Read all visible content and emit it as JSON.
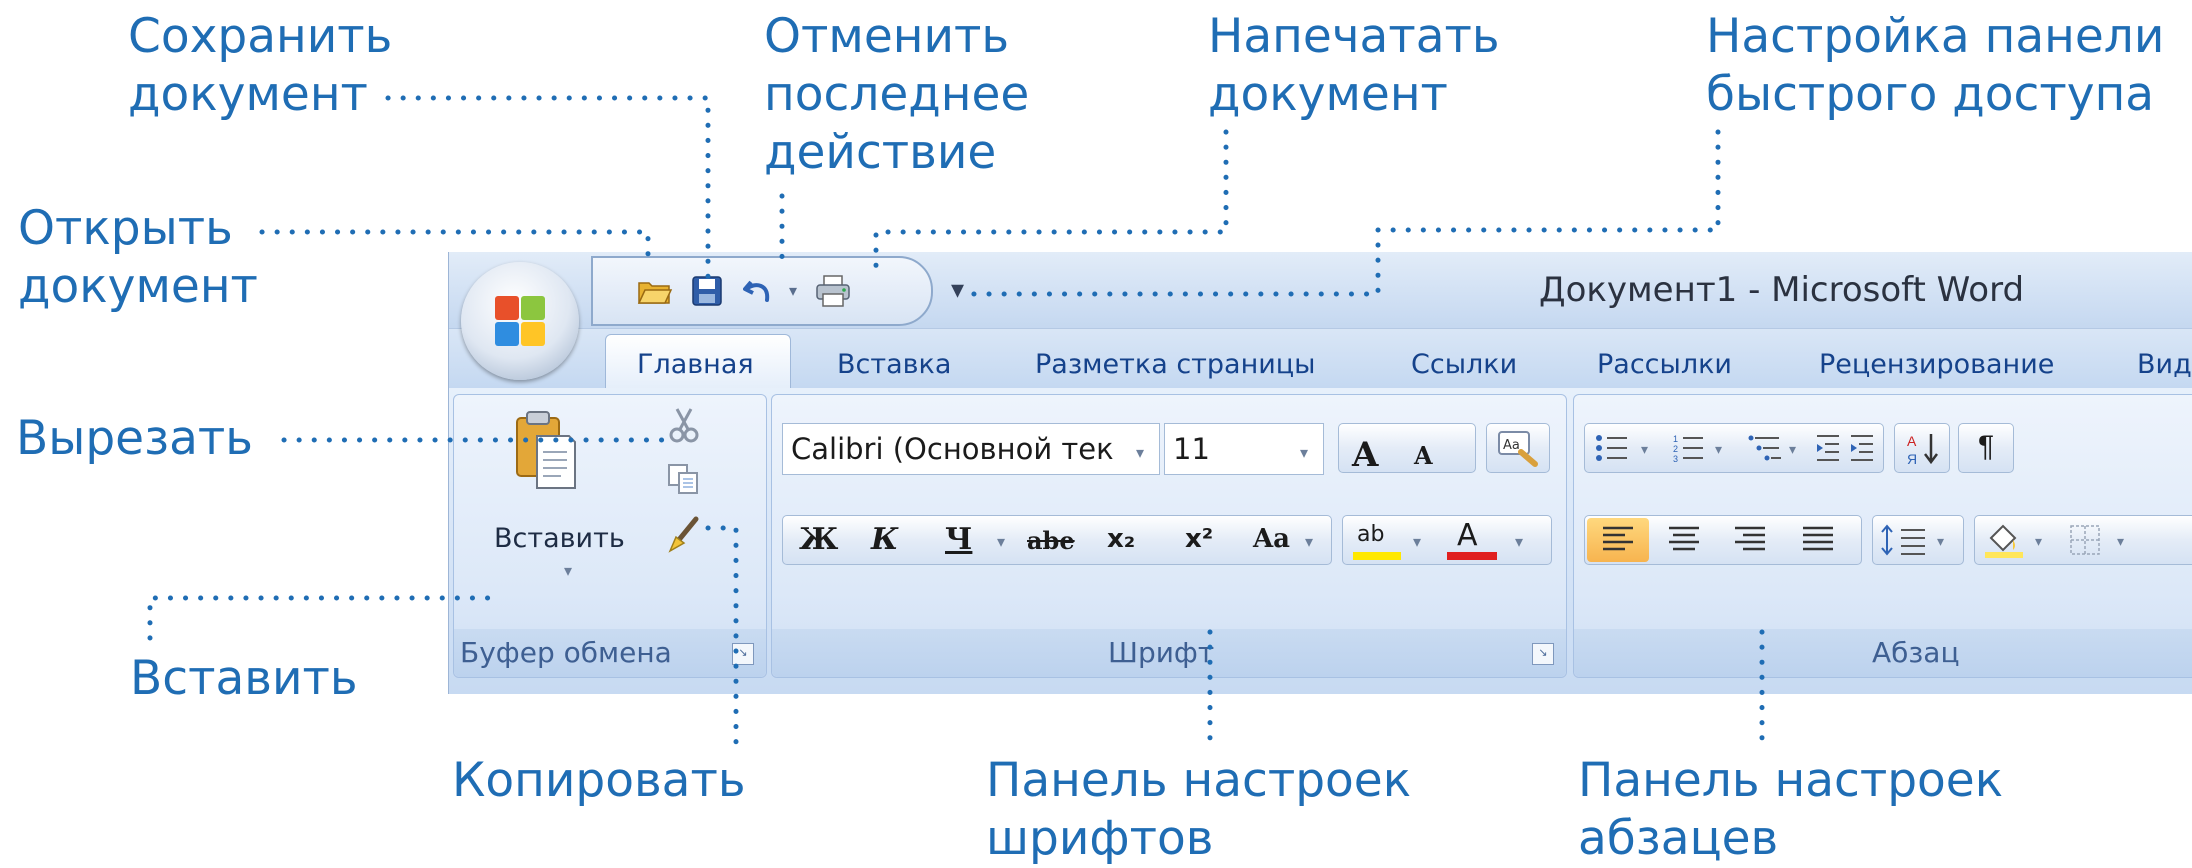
{
  "annotations": {
    "save": "Сохранить\nдокумент",
    "undo": "Отменить\nпоследнее\nдействие",
    "print": "Напечатать\nдокумент",
    "customize": "Настройка панели\nбыстрого доступа",
    "open": "Открыть\nдокумент",
    "cut": "Вырезать",
    "paste": "Вставить",
    "copy": "Копировать",
    "font_panel": "Панель настроек\nшрифтов",
    "paragraph_panel": "Панель настроек\nабзацев"
  },
  "window": {
    "title": "Документ1 - Microsoft Word"
  },
  "tabs": [
    "Главная",
    "Вставка",
    "Разметка страницы",
    "Ссылки",
    "Рассылки",
    "Рецензирование",
    "Вид"
  ],
  "groups": {
    "clipboard": {
      "title": "Буфер обмена",
      "paste_label": "Вставить"
    },
    "font": {
      "title": "Шрифт",
      "font_name": "Calibri (Основной тек",
      "font_size": "11",
      "bold": "Ж",
      "italic": "К",
      "underline": "Ч",
      "strike": "abe",
      "subscript": "x₂",
      "superscript": "x²",
      "case": "Aa",
      "grow": "A",
      "shrink": "A",
      "highlight": "ab",
      "color": "A"
    },
    "paragraph": {
      "title": "Абзац",
      "pilcrow": "¶"
    }
  },
  "colors": {
    "accent_text": "#1f6db4",
    "dots": "#1f6db4",
    "highlight_yellow": "#ffe800",
    "font_red": "#e01f1f",
    "active_align": "#f7b44f"
  },
  "icons": [
    "office-logo-icon",
    "open-folder-icon",
    "save-disk-icon",
    "undo-icon",
    "print-icon",
    "customize-arrow-icon",
    "scissors-icon",
    "copy-icon",
    "format-painter-icon",
    "clipboard-paste-icon"
  ]
}
